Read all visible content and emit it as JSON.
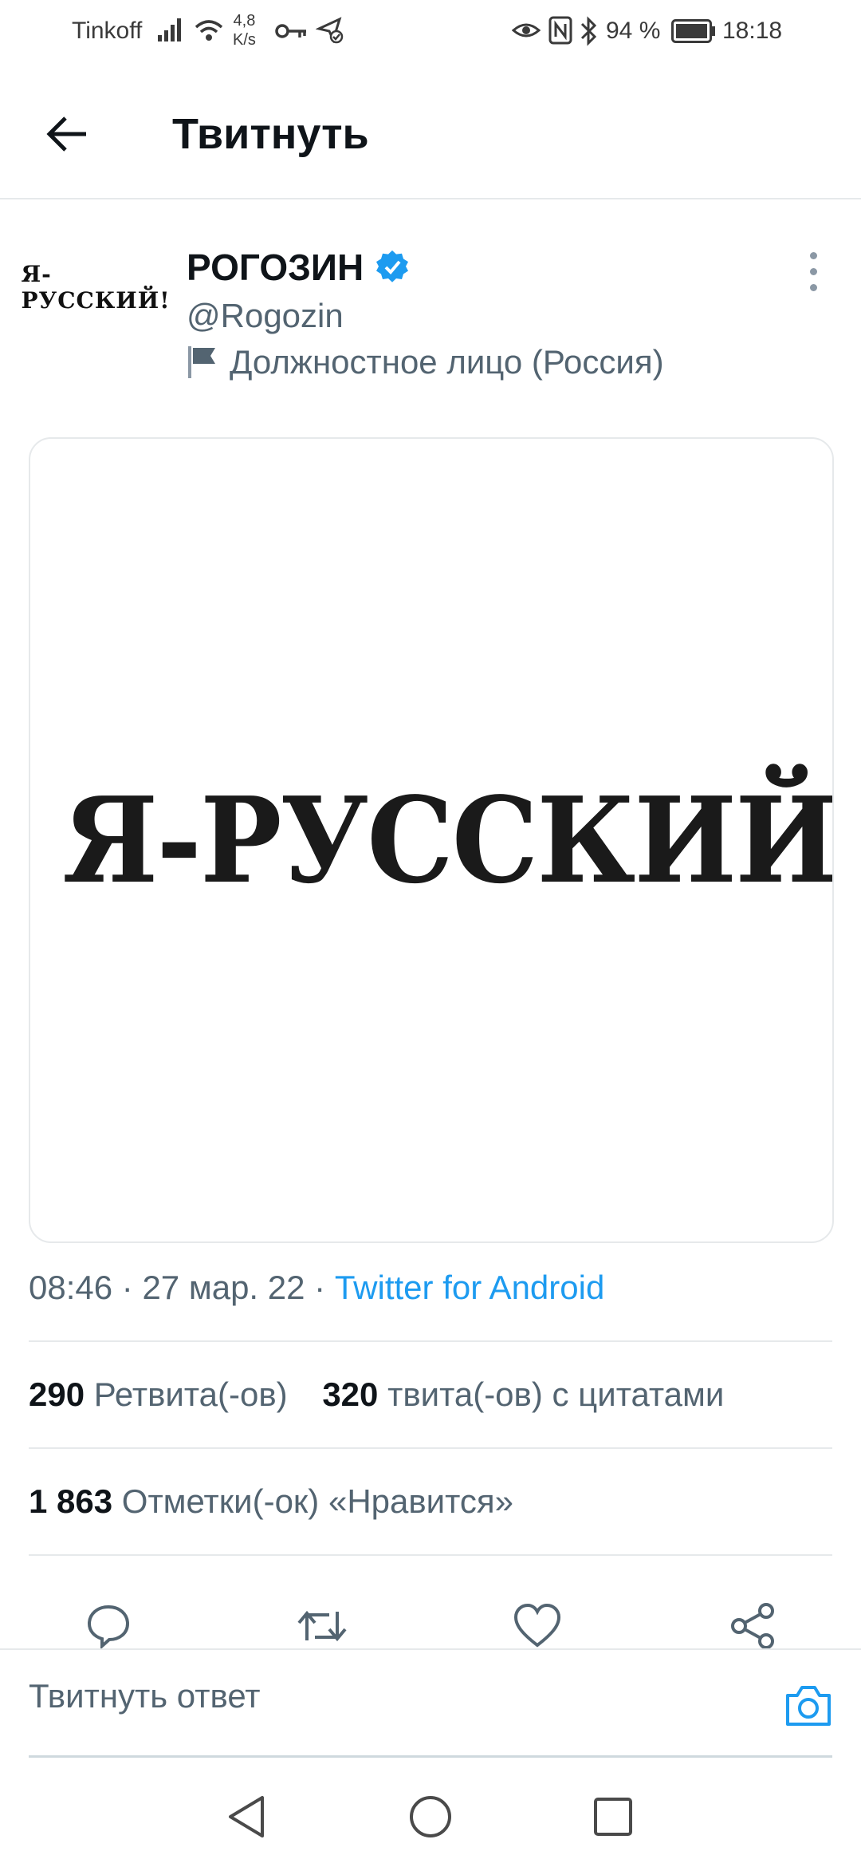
{
  "status_bar": {
    "carrier": "Tinkoff",
    "speed_value": "4,8",
    "speed_unit": "K/s",
    "battery": "94 %",
    "time": "18:18"
  },
  "header": {
    "title": "Твитнуть"
  },
  "tweet": {
    "avatar_text": "Я-РУССКИЙ!",
    "author_name": "РОГОЗИН",
    "handle": "@Rogozin",
    "account_label": "Должностное лицо (Россия)",
    "image_text": "Я-РУССКИЙ!",
    "time": "08:46",
    "separator": "·",
    "date": "27 мар. 22",
    "source": "Twitter for Android"
  },
  "stats": {
    "retweets_count": "290",
    "retweets_label": "Ретвита(-ов)",
    "quotes_count": "320",
    "quotes_label": "твита(-ов) с цитатами",
    "likes_count": "1 863",
    "likes_label": "Отметки(-ок) «Нравится»"
  },
  "reply": {
    "placeholder": "Твитнуть ответ"
  },
  "colors": {
    "accent": "#1d9bf0",
    "secondary_text": "#536471",
    "divider": "#e6e9eb"
  },
  "icons": {
    "back": "arrow-left-icon",
    "verified": "verified-badge-icon",
    "label": "flag-icon",
    "more": "vertical-ellipsis-icon",
    "reply": "comment-icon",
    "retweet": "retweet-icon",
    "like": "heart-icon",
    "share": "share-icon",
    "camera": "camera-icon"
  }
}
